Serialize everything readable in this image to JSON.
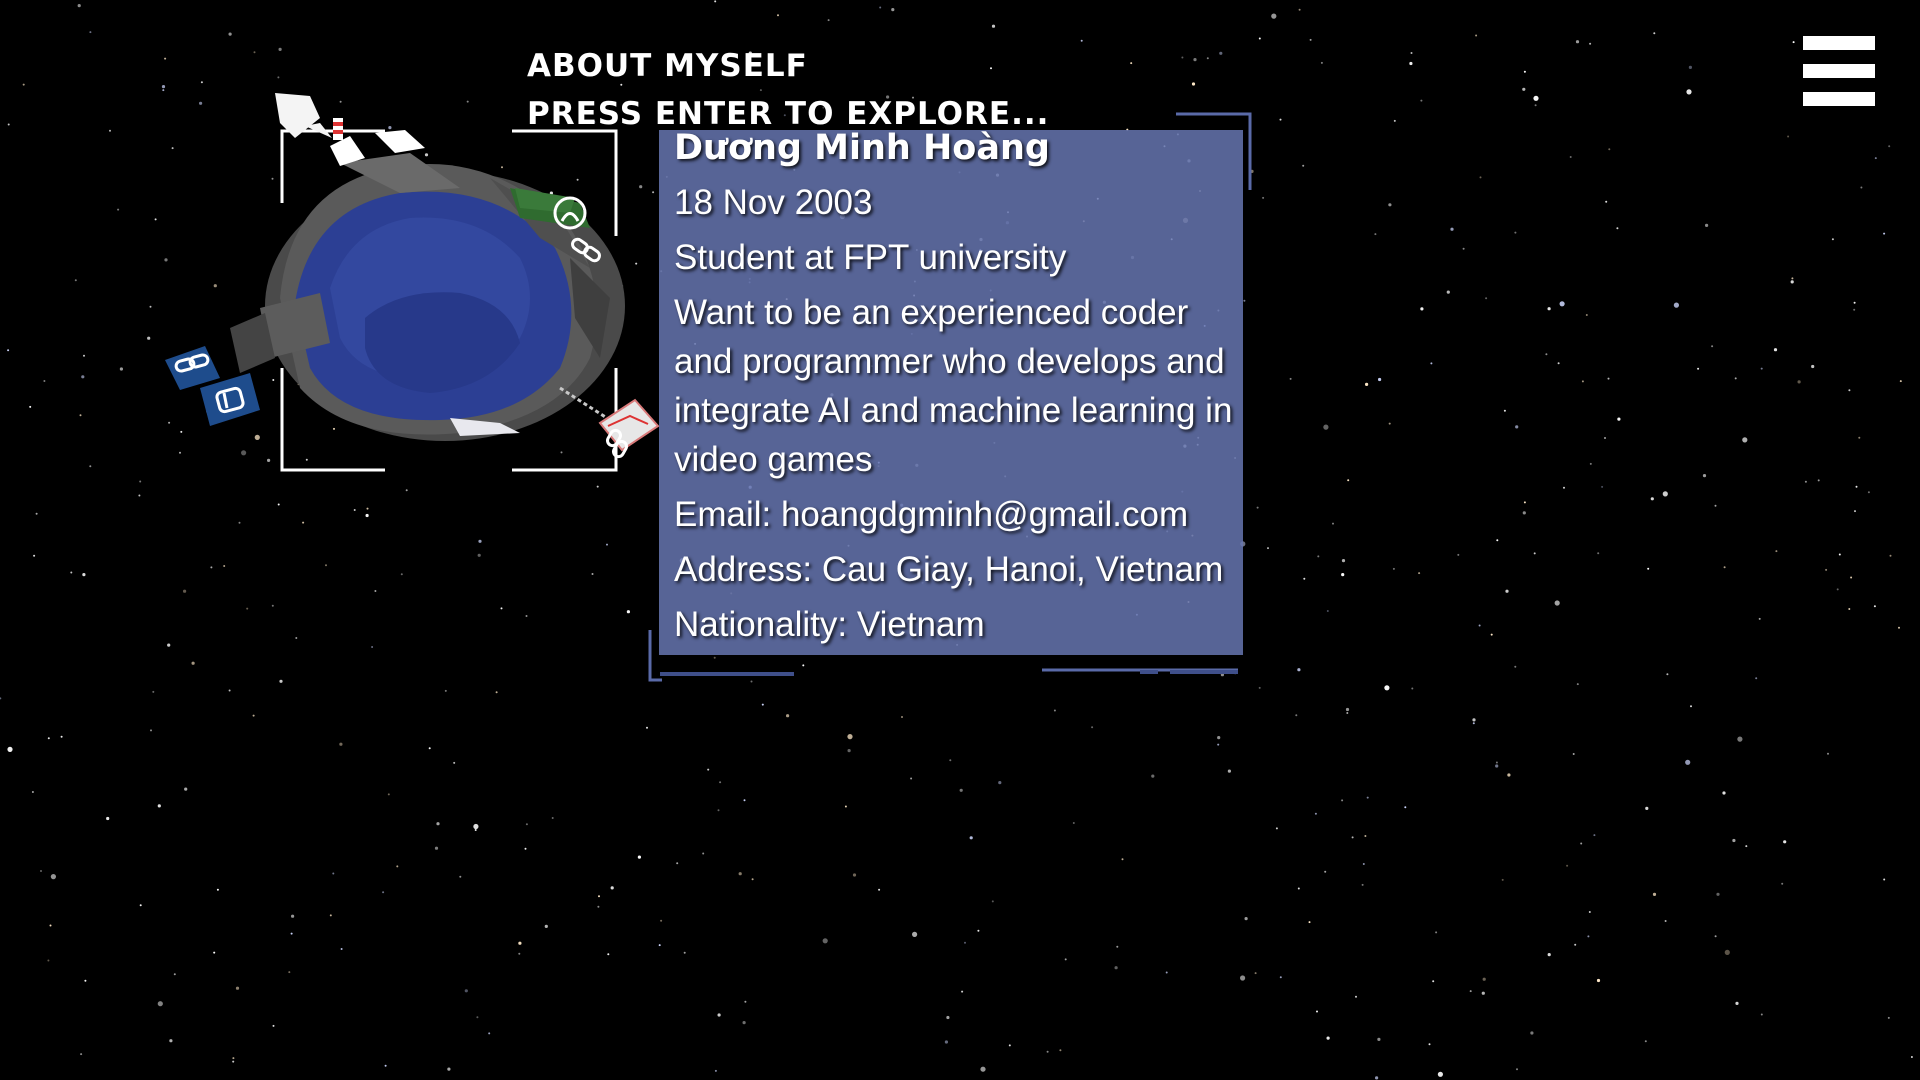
{
  "hud": {
    "title_line1": "ABOUT MYSELF",
    "title_line2": "PRESS ENTER TO EXPLORE..."
  },
  "menu": {
    "icon": "hamburger-menu-icon"
  },
  "planet": {
    "icons": [
      "github-icon",
      "link-icon",
      "link-icon",
      "linkedin-icon",
      "link-icon",
      "mail-icon",
      "flag-icon"
    ]
  },
  "profile": {
    "name": "Dương Minh Hoàng",
    "birthday": "18 Nov 2003",
    "occupation": "Student at FPT university",
    "goal": "Want to be an experienced coder and programmer who develops and integrate AI and machine learning in video games",
    "email": "Email: hoangdgminh@gmail.com",
    "address": "Address: Cau Giay, Hanoi, Vietnam",
    "nationality": "Nationality: Vietnam"
  },
  "colors": {
    "background": "#000000",
    "panel": "#6676b0",
    "frame": "#5a6aa8",
    "ocean": "#2a3f8f",
    "rock": "#555555",
    "text": "#ffffff"
  }
}
